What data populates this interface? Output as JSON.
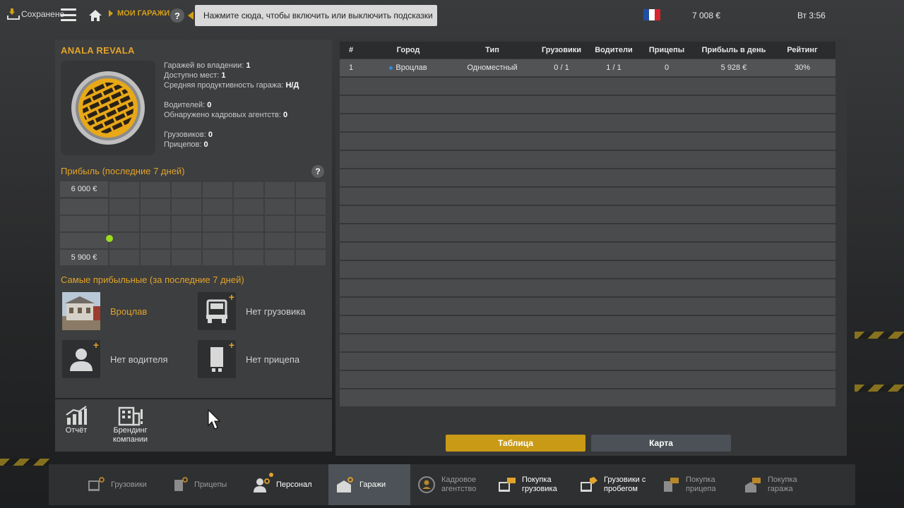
{
  "topbar": {
    "save_label": "Сохранено",
    "breadcrumb": "МОИ ГАРАЖИ",
    "hint": "Нажмите сюда, чтобы включить или выключить подсказки",
    "help": "?",
    "money": "7 008 €",
    "clock": "Вт 3:56"
  },
  "garage": {
    "name": "ANALA REVALA",
    "stats": {
      "owned_label": "Гаражей во владении:",
      "owned": "1",
      "slots_label": "Доступно мест:",
      "slots": "1",
      "productivity_label": "Средняя продуктивность гаража:",
      "productivity": "Н/Д",
      "drivers_label": "Водителей:",
      "drivers": "0",
      "agencies_label": "Обнаружено кадровых агентств:",
      "agencies": "0",
      "trucks_label": "Грузовиков:",
      "trucks": "0",
      "trailers_label": "Прицепов:",
      "trailers": "0"
    },
    "profit_title": "Прибыль (последние 7 дней)",
    "profit_max": "6 000 €",
    "profit_min": "5 900 €",
    "best_title": "Самые прибыльные (за последние 7 дней)",
    "best": {
      "city": "Вроцлав",
      "truck": "Нет грузовика",
      "driver": "Нет водителя",
      "trailer": "Нет прицепа"
    },
    "actions": {
      "report": "Отчёт",
      "branding_1": "Брендинг",
      "branding_2": "компании"
    }
  },
  "chart_data": {
    "type": "scatter",
    "title": "Прибыль (последние 7 дней)",
    "ylim": [
      5900,
      6000
    ],
    "y_tick_labels": [
      "6 000 €",
      "5 900 €"
    ],
    "x": [
      1
    ],
    "values": [
      5928
    ]
  },
  "table": {
    "headers": [
      "#",
      "Город",
      "Тип",
      "Грузовики",
      "Водители",
      "Прицепы",
      "Прибыль в день",
      "Рейтинг"
    ],
    "rows": [
      [
        "1",
        "Вроцлав",
        "Одноместный",
        "0 / 1",
        "1 / 1",
        "0",
        "5 928 €",
        "30%"
      ]
    ],
    "empty_rows": 18
  },
  "view_buttons": {
    "table": "Таблица",
    "map": "Карта"
  },
  "nav": [
    {
      "l1": "Грузовики",
      "l2": ""
    },
    {
      "l1": "Прицепы",
      "l2": ""
    },
    {
      "l1": "Персонал",
      "l2": ""
    },
    {
      "l1": "Гаражи",
      "l2": ""
    },
    {
      "l1": "Кадровое",
      "l2": "агентство"
    },
    {
      "l1": "Покупка",
      "l2": "грузовика"
    },
    {
      "l1": "Грузовики с",
      "l2": "пробегом"
    },
    {
      "l1": "Покупка",
      "l2": "прицепа"
    },
    {
      "l1": "Покупка",
      "l2": "гаража"
    }
  ],
  "colors": {
    "accent": "#e2a32b",
    "active_button": "#c99a16",
    "chart_point": "#9bdc1e"
  }
}
